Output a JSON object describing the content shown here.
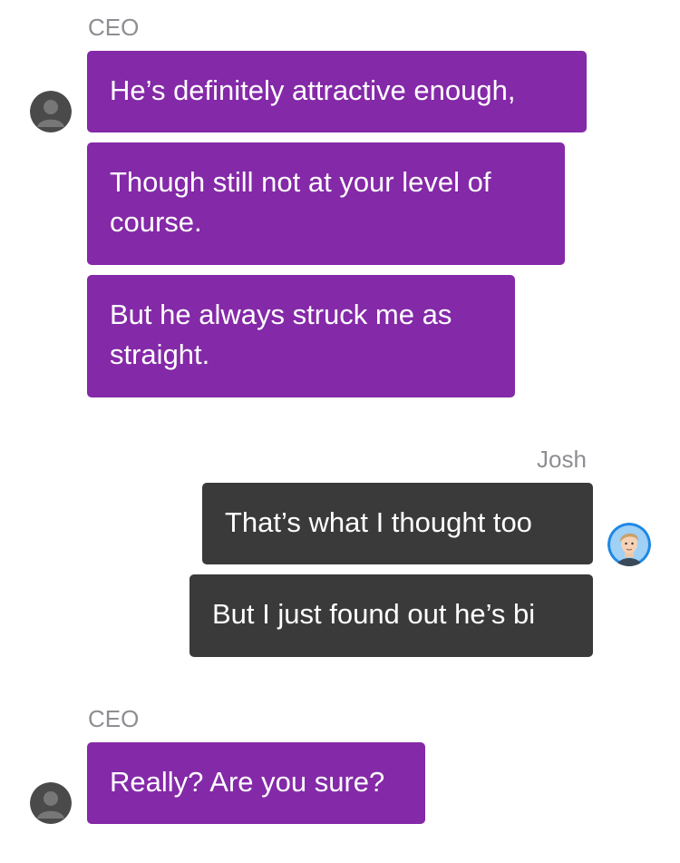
{
  "conversation": {
    "groups": [
      {
        "sender": "CEO",
        "avatar_icon": "default-user-avatar-icon",
        "messages": [
          "He’s definitely attractive enough,",
          "Though still not at your level of course.",
          "But he always struck me as straight."
        ]
      },
      {
        "sender": "Josh",
        "avatar_icon": "josh-profile-avatar-icon",
        "messages": [
          "That’s what I thought too",
          "But I just found out he’s bi"
        ]
      },
      {
        "sender": "CEO",
        "avatar_icon": "default-user-avatar-icon",
        "messages": [
          "Really? Are you sure?"
        ]
      }
    ]
  },
  "colors": {
    "ceo_bubble": "#8429a8",
    "josh_bubble": "#3a3a3a",
    "sender_name": "#8e8e93",
    "josh_avatar_ring": "#1e88e5"
  }
}
